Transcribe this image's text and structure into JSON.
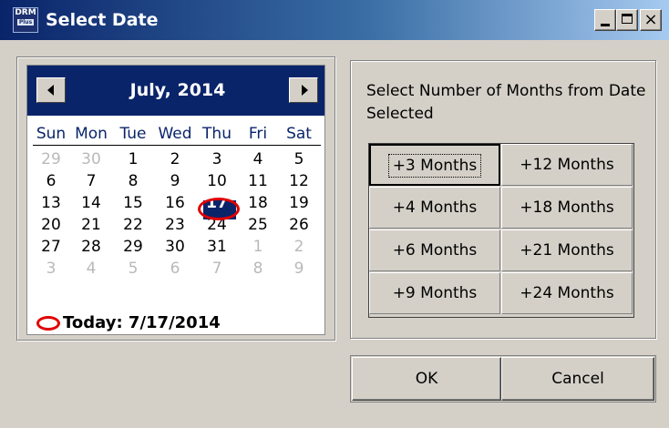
{
  "window": {
    "title": "Select Date",
    "app_icon_text": "DRM",
    "app_icon_subtext": "Plus",
    "minimize_label": "_",
    "maximize_label": "□",
    "close_label": "×"
  },
  "calendar": {
    "month_label": "July, 2014",
    "day_names": [
      "Sun",
      "Mon",
      "Tue",
      "Wed",
      "Thu",
      "Fri",
      "Sat"
    ],
    "weeks": [
      [
        {
          "d": "29",
          "muted": true
        },
        {
          "d": "30",
          "muted": true
        },
        {
          "d": "1"
        },
        {
          "d": "2"
        },
        {
          "d": "3"
        },
        {
          "d": "4"
        },
        {
          "d": "5"
        }
      ],
      [
        {
          "d": "6"
        },
        {
          "d": "7"
        },
        {
          "d": "8"
        },
        {
          "d": "9"
        },
        {
          "d": "10"
        },
        {
          "d": "11"
        },
        {
          "d": "12"
        }
      ],
      [
        {
          "d": "13"
        },
        {
          "d": "14"
        },
        {
          "d": "15"
        },
        {
          "d": "16"
        },
        {
          "d": "17",
          "selected": true
        },
        {
          "d": "18"
        },
        {
          "d": "19"
        }
      ],
      [
        {
          "d": "20"
        },
        {
          "d": "21"
        },
        {
          "d": "22"
        },
        {
          "d": "23"
        },
        {
          "d": "24"
        },
        {
          "d": "25"
        },
        {
          "d": "26"
        }
      ],
      [
        {
          "d": "27"
        },
        {
          "d": "28"
        },
        {
          "d": "29"
        },
        {
          "d": "30"
        },
        {
          "d": "31"
        },
        {
          "d": "1",
          "muted": true
        },
        {
          "d": "2",
          "muted": true
        }
      ],
      [
        {
          "d": "3",
          "muted": true
        },
        {
          "d": "4",
          "muted": true
        },
        {
          "d": "5",
          "muted": true
        },
        {
          "d": "6",
          "muted": true
        },
        {
          "d": "7",
          "muted": true
        },
        {
          "d": "8",
          "muted": true
        },
        {
          "d": "9",
          "muted": true
        }
      ]
    ],
    "selected_day": "17",
    "today_label": "Today: 7/17/2014"
  },
  "months_panel": {
    "label": "Select Number of Months from Date Selected",
    "buttons": [
      "+3 Months",
      "+12 Months",
      "+4 Months",
      "+18 Months",
      "+6 Months",
      "+21 Months",
      "+9 Months",
      "+24 Months"
    ]
  },
  "dialog": {
    "ok_label": "OK",
    "cancel_label": "Cancel"
  },
  "colors": {
    "title_bar": "#0a246a",
    "selection": "#0a246a",
    "today_marker": "#e00000",
    "face": "#d4d0c8"
  },
  "icons": {
    "prev": "triangle-left-icon",
    "next": "triangle-right-icon"
  }
}
